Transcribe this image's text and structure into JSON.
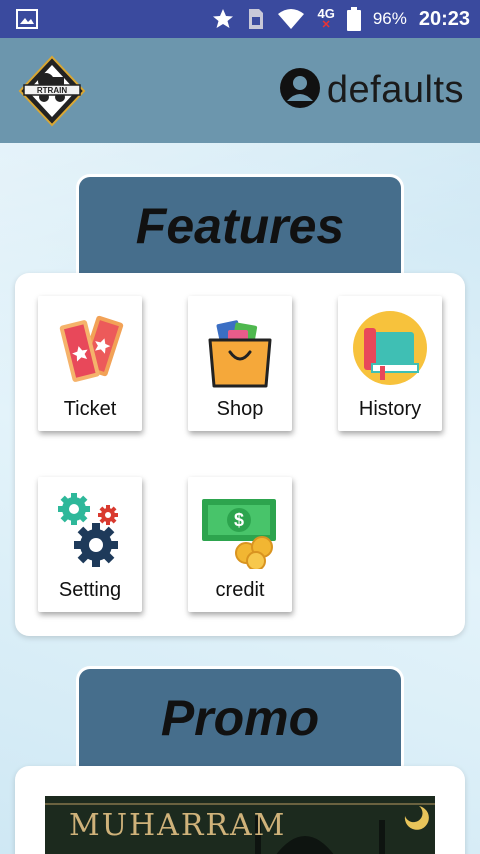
{
  "status_bar": {
    "network": "4G",
    "battery": "96%",
    "time": "20:23",
    "icons": [
      "image-icon",
      "star-icon",
      "sim-icon",
      "wifi-icon",
      "battery-icon"
    ]
  },
  "header": {
    "logo_text": "RTRAIN",
    "username": "defaults"
  },
  "features": {
    "title": "Features",
    "items": [
      {
        "label": "Ticket",
        "icon": "ticket-icon"
      },
      {
        "label": "Shop",
        "icon": "shopping-bag-icon"
      },
      {
        "label": "History",
        "icon": "book-icon"
      },
      {
        "label": "Setting",
        "icon": "gears-icon"
      },
      {
        "label": "credit",
        "icon": "money-icon"
      }
    ]
  },
  "promo": {
    "title": "Promo",
    "banner_text": "MUHARRAM"
  },
  "colors": {
    "status_bar": "#3a4a9e",
    "header": "#6c96ad",
    "section_tab": "#466e8c",
    "background": "#d4ecf6"
  }
}
